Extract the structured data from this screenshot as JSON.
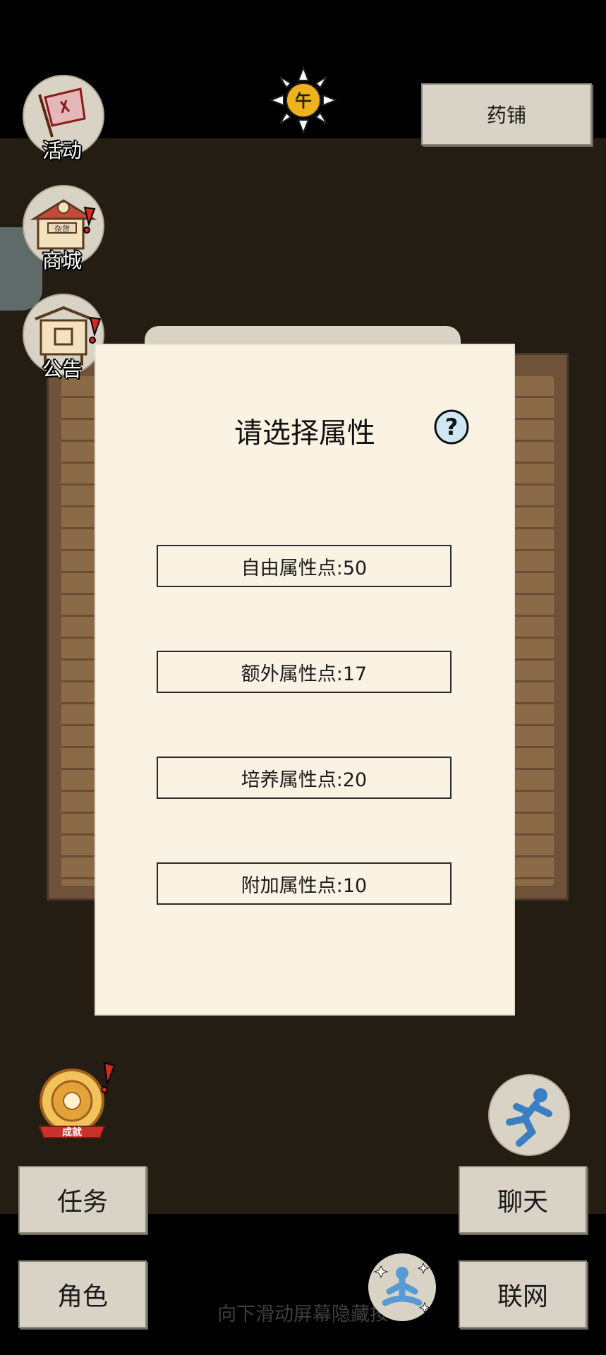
{
  "top": {
    "time_glyph": "午",
    "shop_button": "药铺"
  },
  "left_icons": {
    "activity": "活动",
    "mall": "商城",
    "notice": "公告",
    "mall_sign": "杂货"
  },
  "dialog": {
    "title": "请选择属性",
    "help_glyph": "?",
    "options": [
      "自由属性点:50",
      "额外属性点:17",
      "培养属性点:20",
      "附加属性点:10"
    ]
  },
  "achievement_label": "成就",
  "buttons": {
    "task": "任务",
    "chat": "聊天",
    "role": "角色",
    "network": "联网"
  },
  "hint": "向下滑动屏幕隐藏按",
  "colors": {
    "dialog_bg": "#faf3e4",
    "button_bg": "#d8d3c6",
    "scene_bg": "#231d13",
    "alert": "#d42a1f"
  }
}
